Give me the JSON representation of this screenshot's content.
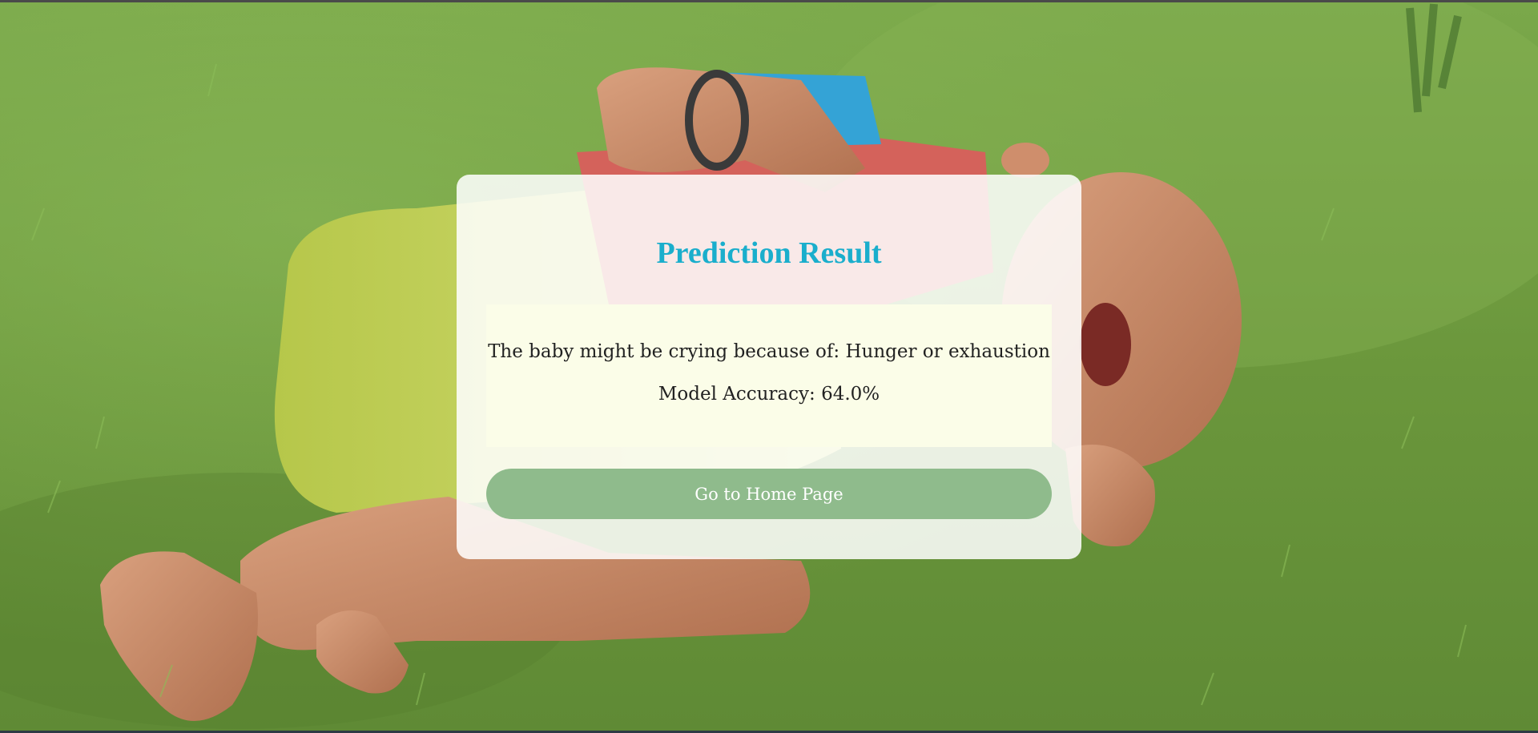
{
  "card": {
    "title": "Prediction Result",
    "result_text": "The baby might be crying because of: Hunger or exhaustion",
    "accuracy_text": "Model Accuracy: 64.0%",
    "home_button_label": "Go to Home Page"
  },
  "colors": {
    "title": "#1aaecc",
    "result_box_background": "#fbfde8",
    "button_background": "#8fbb8c",
    "grass": "#6d9a3e"
  },
  "background": {
    "image": "crying-baby-on-grass-photo"
  }
}
